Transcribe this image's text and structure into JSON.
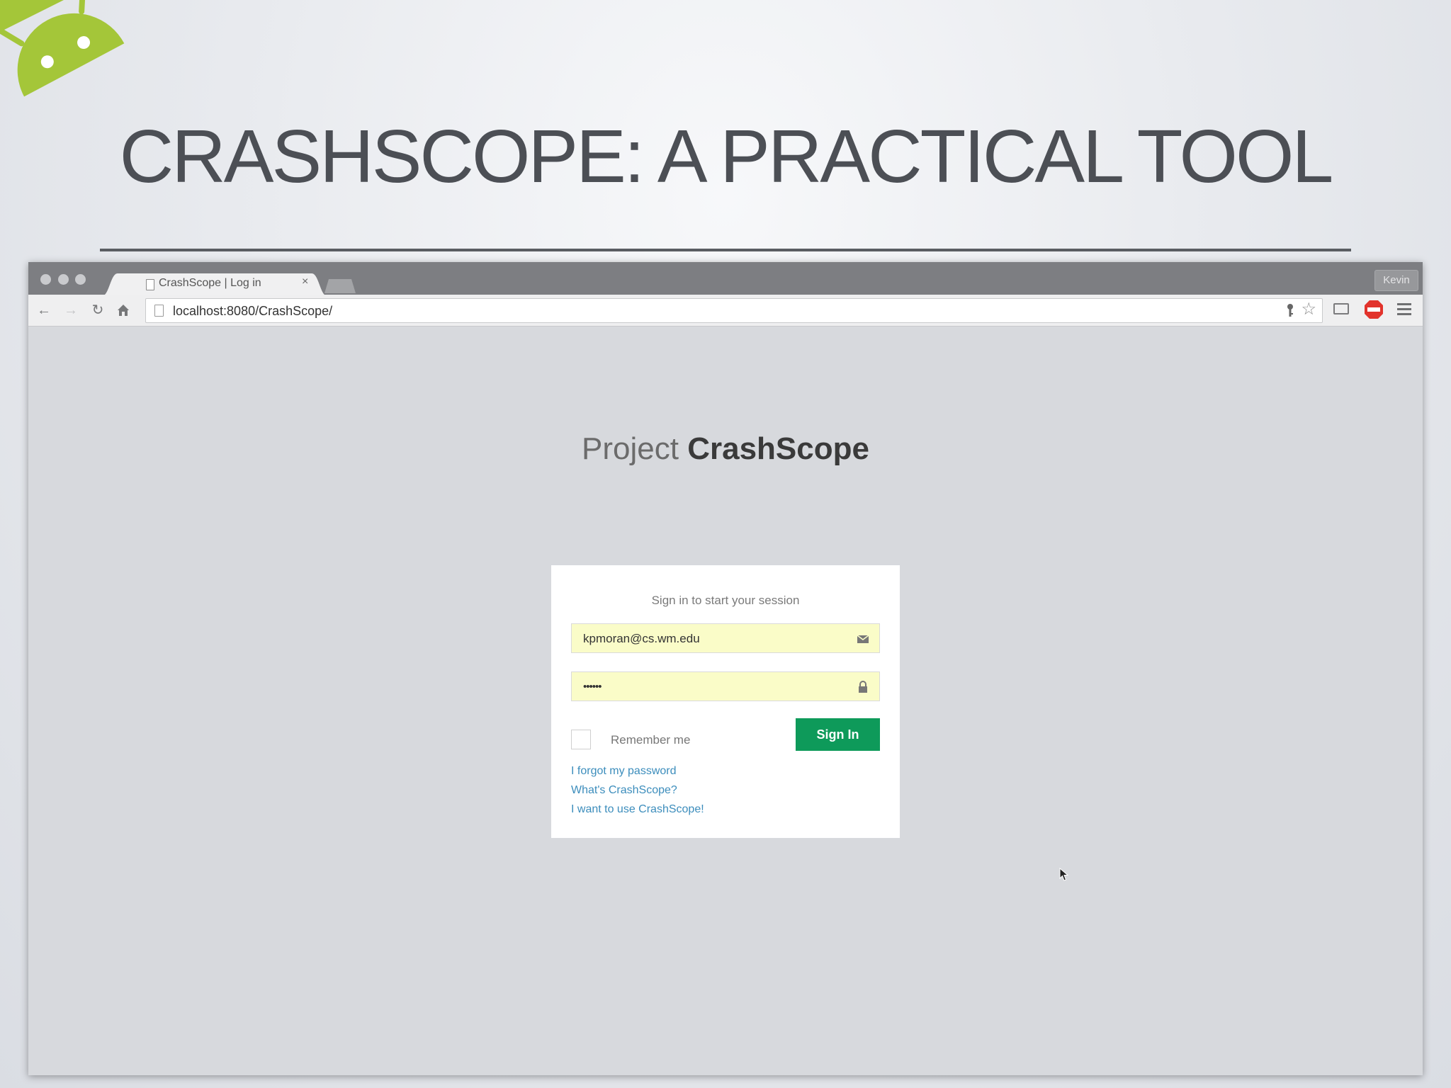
{
  "slide": {
    "title": "CRASHSCOPE: A PRACTICAL TOOL",
    "logo_icon": "android-robot-icon",
    "accent_color": "#a4c639"
  },
  "browser": {
    "tab": {
      "title": "CrashScope | Log in",
      "close_glyph": "×"
    },
    "profile_label": "Kevin",
    "address_bar": {
      "url": "localhost:8080/CrashScope/"
    },
    "toolbar_icons": [
      "back-icon",
      "forward-icon",
      "reload-icon",
      "home-icon",
      "key-icon",
      "star-icon",
      "cast-icon",
      "adblock-icon",
      "menu-icon"
    ]
  },
  "page": {
    "brand_light": "Project ",
    "brand_bold": "CrashScope",
    "login": {
      "message": "Sign in to start your session",
      "email_value": "kpmoran@cs.wm.edu",
      "password_value": "••••••",
      "remember_label": "Remember me",
      "sign_in_label": "Sign In",
      "button_color": "#0e9a5a",
      "field_bg": "#fafcc8",
      "links": [
        "I forgot my password",
        "What's CrashScope?",
        "I want to use CrashScope!"
      ]
    }
  }
}
